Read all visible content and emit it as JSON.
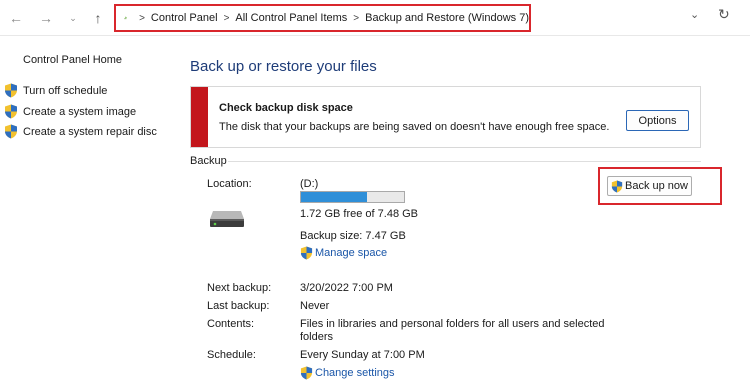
{
  "nav": {
    "back_icon": "arrow-left-icon",
    "forward_icon": "arrow-right-icon",
    "recent_icon": "chevron-down-icon",
    "up_icon": "arrow-up-icon",
    "back_glyph": "←",
    "forward_glyph": "→",
    "recent_glyph": "⌄",
    "up_glyph": "↑",
    "dropdown_glyph": "⌄",
    "refresh_glyph": "↻"
  },
  "breadcrumb": [
    "Control Panel",
    "All Control Panel Items",
    "Backup and Restore (Windows 7)"
  ],
  "sidebar": {
    "home": "Control Panel Home",
    "links": [
      {
        "label": "Turn off schedule",
        "icon": "shield-icon"
      },
      {
        "label": "Create a system image",
        "icon": "shield-icon"
      },
      {
        "label": "Create a system repair disc",
        "icon": "shield-icon"
      }
    ]
  },
  "main": {
    "title": "Back up or restore your files",
    "alert": {
      "title": "Check backup disk space",
      "text": "The disk that your backups are being saved on doesn't have enough free space.",
      "button": "Options"
    },
    "section": "Backup",
    "location_label": "Location:",
    "location_value": "(D:)",
    "disk_usage_fraction": 0.64,
    "free_space": "1.72 GB free of 7.48 GB",
    "backup_size": "Backup size: 7.47 GB",
    "manage_space": "Manage space",
    "back_up_now": "Back up now",
    "next_backup_label": "Next backup:",
    "next_backup_value": "3/20/2022 7:00 PM",
    "last_backup_label": "Last backup:",
    "last_backup_value": "Never",
    "contents_label": "Contents:",
    "contents_value_line1": "Files in libraries and personal folders for all users and selected",
    "contents_value_line2": "folders",
    "schedule_label": "Schedule:",
    "schedule_value": "Every Sunday at 7:00 PM",
    "change_settings": "Change settings"
  },
  "colors": {
    "title_blue": "#1e3c78",
    "link_blue": "#1a56a8",
    "alert_red": "#c3161c",
    "highlight_red": "#d9262c",
    "progress_blue": "#2f8fd8"
  }
}
